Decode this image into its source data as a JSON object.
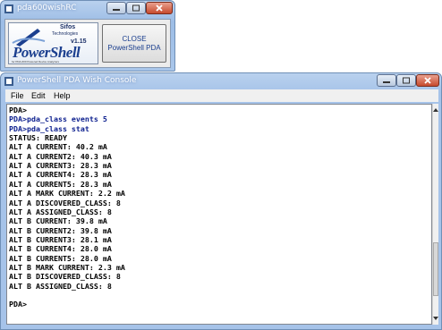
{
  "launcher": {
    "title": "pda600wishRC",
    "logo_company": "Sifos",
    "logo_tagline": "Technologies",
    "logo_version": "v1.15",
    "logo_product": "PowerShell",
    "logo_subtitle": "for PDA-600 Powered Device Analyzers",
    "close_button_line1": "CLOSE",
    "close_button_line2": "PowerShell PDA"
  },
  "console_window": {
    "title": "PowerShell PDA Wish Console",
    "menu": [
      "File",
      "Edit",
      "Help"
    ],
    "lines": [
      {
        "text": "PDA>",
        "cmd": false
      },
      {
        "text": "PDA>pda_class events 5",
        "cmd": true
      },
      {
        "text": "PDA>pda_class stat",
        "cmd": true
      },
      {
        "text": "STATUS: READY",
        "cmd": false
      },
      {
        "text": "ALT A CURRENT: 40.2 mA",
        "cmd": false
      },
      {
        "text": "ALT A CURRENT2: 40.3 mA",
        "cmd": false
      },
      {
        "text": "ALT A CURRENT3: 28.3 mA",
        "cmd": false
      },
      {
        "text": "ALT A CURRENT4: 28.3 mA",
        "cmd": false
      },
      {
        "text": "ALT A CURRENT5: 28.3 mA",
        "cmd": false
      },
      {
        "text": "ALT A MARK CURRENT: 2.2 mA",
        "cmd": false
      },
      {
        "text": "ALT A DISCOVERED_CLASS: 8",
        "cmd": false
      },
      {
        "text": "ALT A ASSIGNED_CLASS: 8",
        "cmd": false
      },
      {
        "text": "ALT B CURRENT: 39.8 mA",
        "cmd": false
      },
      {
        "text": "ALT B CURRENT2: 39.8 mA",
        "cmd": false
      },
      {
        "text": "ALT B CURRENT3: 28.1 mA",
        "cmd": false
      },
      {
        "text": "ALT B CURRENT4: 28.0 mA",
        "cmd": false
      },
      {
        "text": "ALT B CURRENT5: 28.0 mA",
        "cmd": false
      },
      {
        "text": "ALT B MARK CURRENT: 2.3 mA",
        "cmd": false
      },
      {
        "text": "ALT B DISCOVERED_CLASS: 8",
        "cmd": false
      },
      {
        "text": "ALT B ASSIGNED_CLASS: 8",
        "cmd": false
      },
      {
        "text": "",
        "cmd": false
      },
      {
        "text": "PDA>",
        "cmd": false
      }
    ]
  },
  "colors": {
    "command_text": "#0c1f8e",
    "output_text": "#000000",
    "title_bar": "#a6c3e9"
  }
}
